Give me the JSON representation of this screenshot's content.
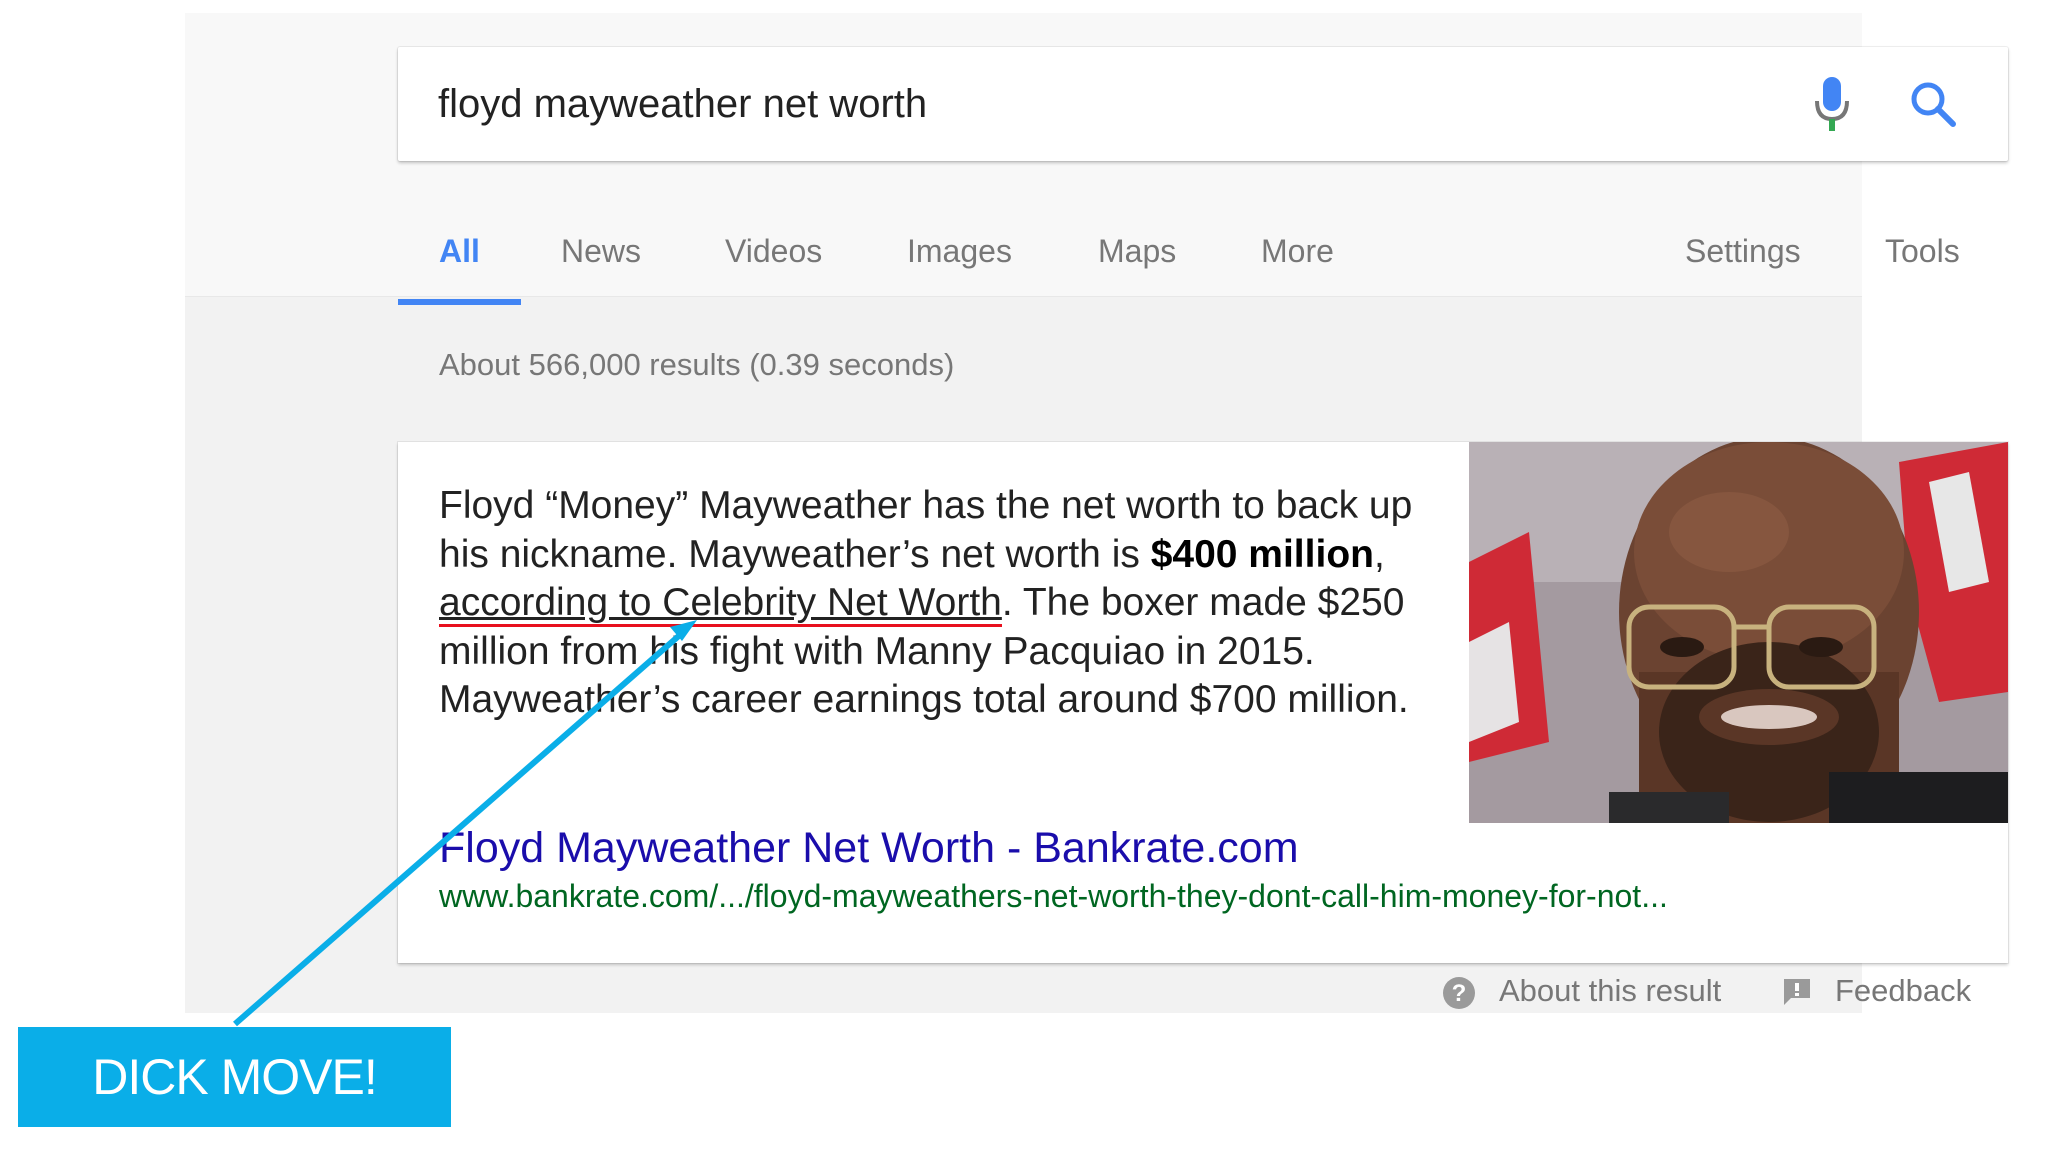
{
  "search": {
    "query": "floyd mayweather net worth",
    "mic_icon": "microphone-icon",
    "search_icon": "search-icon"
  },
  "tabs": [
    {
      "label": "All",
      "active": true
    },
    {
      "label": "News"
    },
    {
      "label": "Videos"
    },
    {
      "label": "Images"
    },
    {
      "label": "Maps"
    },
    {
      "label": "More"
    }
  ],
  "tools": {
    "settings_label": "Settings",
    "tools_label": "Tools"
  },
  "result_stats": "About 566,000 results (0.39 seconds)",
  "featured_snippet": {
    "text_1": "Floyd “Money” Mayweather has the net worth to back up his nickname. Mayweather’s net worth is ",
    "bold_value": "$400 million",
    "text_2": ", ",
    "source_phrase": "according to Celebrity Net Worth",
    "text_3": ". The boxer made $250 million from his fight with Manny Pacquiao in 2015. Mayweather’s career earnings total around $700 million.",
    "image_icon": "portrait-photo",
    "result_title": "Floyd Mayweather Net Worth - Bankrate.com",
    "result_url": "www.bankrate.com/.../floyd-mayweathers-net-worth-they-dont-call-him-money-for-not..."
  },
  "footer": {
    "about_label": "About this result",
    "feedback_label": "Feedback",
    "help_icon": "help-circle-icon",
    "feedback_icon": "feedback-flag-icon"
  },
  "annotation": {
    "label": "DICK MOVE!",
    "color": "#0aaee8",
    "underline_color": "#e8101e"
  }
}
